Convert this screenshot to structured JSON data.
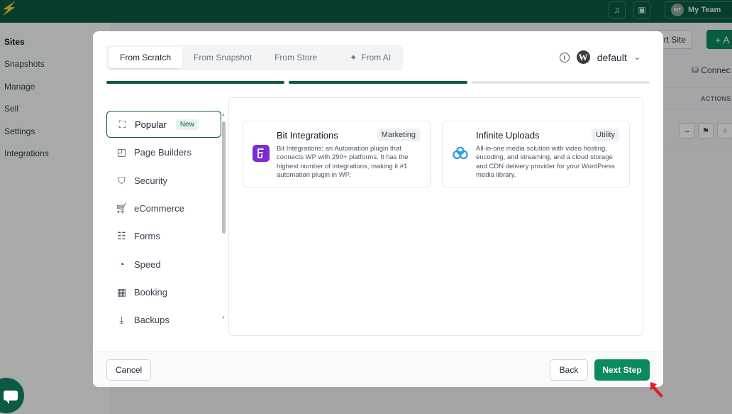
{
  "app": {
    "team_label": "My Team",
    "team_initials": "MT",
    "sidebar": [
      "Sites",
      "Snapshots",
      "Manage",
      "Sell",
      "Settings",
      "Integrations"
    ],
    "import_site_label": "ort Site",
    "add_label": "+ A",
    "connect_label": "Connec",
    "actions_header": "ACTIONS"
  },
  "modal": {
    "tabs": [
      {
        "label": "From Scratch",
        "active": true
      },
      {
        "label": "From Snapshot",
        "active": false
      },
      {
        "label": "From Store",
        "active": false
      },
      {
        "label": "From AI",
        "active": false
      }
    ],
    "wp_version": "default",
    "steps_completed": 2,
    "steps_total": 3,
    "categories": [
      {
        "label": "Popular",
        "badge": "New",
        "icon": "popular-icon",
        "active": true
      },
      {
        "label": "Page Builders",
        "icon": "page-builders-icon"
      },
      {
        "label": "Security",
        "icon": "shield-icon"
      },
      {
        "label": "eCommerce",
        "icon": "cart-icon"
      },
      {
        "label": "Forms",
        "icon": "forms-icon"
      },
      {
        "label": "Speed",
        "icon": "speed-icon"
      },
      {
        "label": "Booking",
        "icon": "calendar-icon"
      },
      {
        "label": "Backups",
        "icon": "backup-icon"
      }
    ],
    "plugins": [
      {
        "title": "Bit Integrations",
        "tag": "Marketing",
        "description": "Bit Integrations: an Automation plugin that connects WP with 290+ platforms. It has the highest number of integrations, making it #1 automation plugin in WP.",
        "logo_color": "#7b2cd6"
      },
      {
        "title": "Infinite Uploads",
        "tag": "Utility",
        "description": "All-in-one media solution with video hosting, encoding, and streaming, and a cloud storage and CDN delivery provider for your WordPress media library.",
        "logo_color": "#2b9fd9"
      }
    ],
    "footer": {
      "cancel_label": "Cancel",
      "back_label": "Back",
      "next_label": "Next Step"
    }
  },
  "colors": {
    "brand_dark": "#0b5a45",
    "primary_button": "#0a8a5f",
    "progress_done": "#0b5a45",
    "progress_pending": "#e5e7eb"
  }
}
